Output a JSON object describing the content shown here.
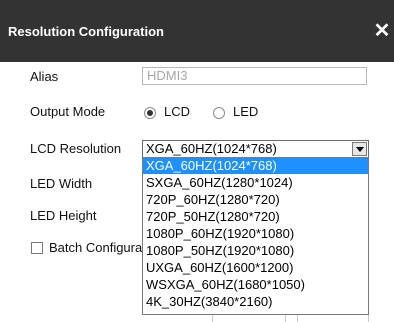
{
  "dialog": {
    "title": "Resolution Configuration",
    "close_glyph": "✕"
  },
  "form": {
    "alias_label": "Alias",
    "alias_value": "HDMI3",
    "output_mode_label": "Output Mode",
    "mode_lcd": "LCD",
    "mode_led": "LED",
    "mode_selected": "LCD",
    "lcd_resolution_label": "LCD Resolution",
    "lcd_resolution_value": "XGA_60HZ(1024*768)",
    "led_width_label": "LED Width",
    "led_height_label": "LED Height",
    "batch_label": "Batch Configura"
  },
  "dropdown": {
    "options": [
      "XGA_60HZ(1024*768)",
      "SXGA_60HZ(1280*1024)",
      "720P_60HZ(1280*720)",
      "720P_50HZ(1280*720)",
      "1080P_60HZ(1920*1080)",
      "1080P_50HZ(1920*1080)",
      "UXGA_60HZ(1600*1200)",
      "WSXGA_60HZ(1680*1050)",
      "4K_30HZ(3840*2160)"
    ],
    "highlighted_index": 0
  },
  "colors": {
    "titlebar": "#333333",
    "highlight": "#1e90ff"
  }
}
